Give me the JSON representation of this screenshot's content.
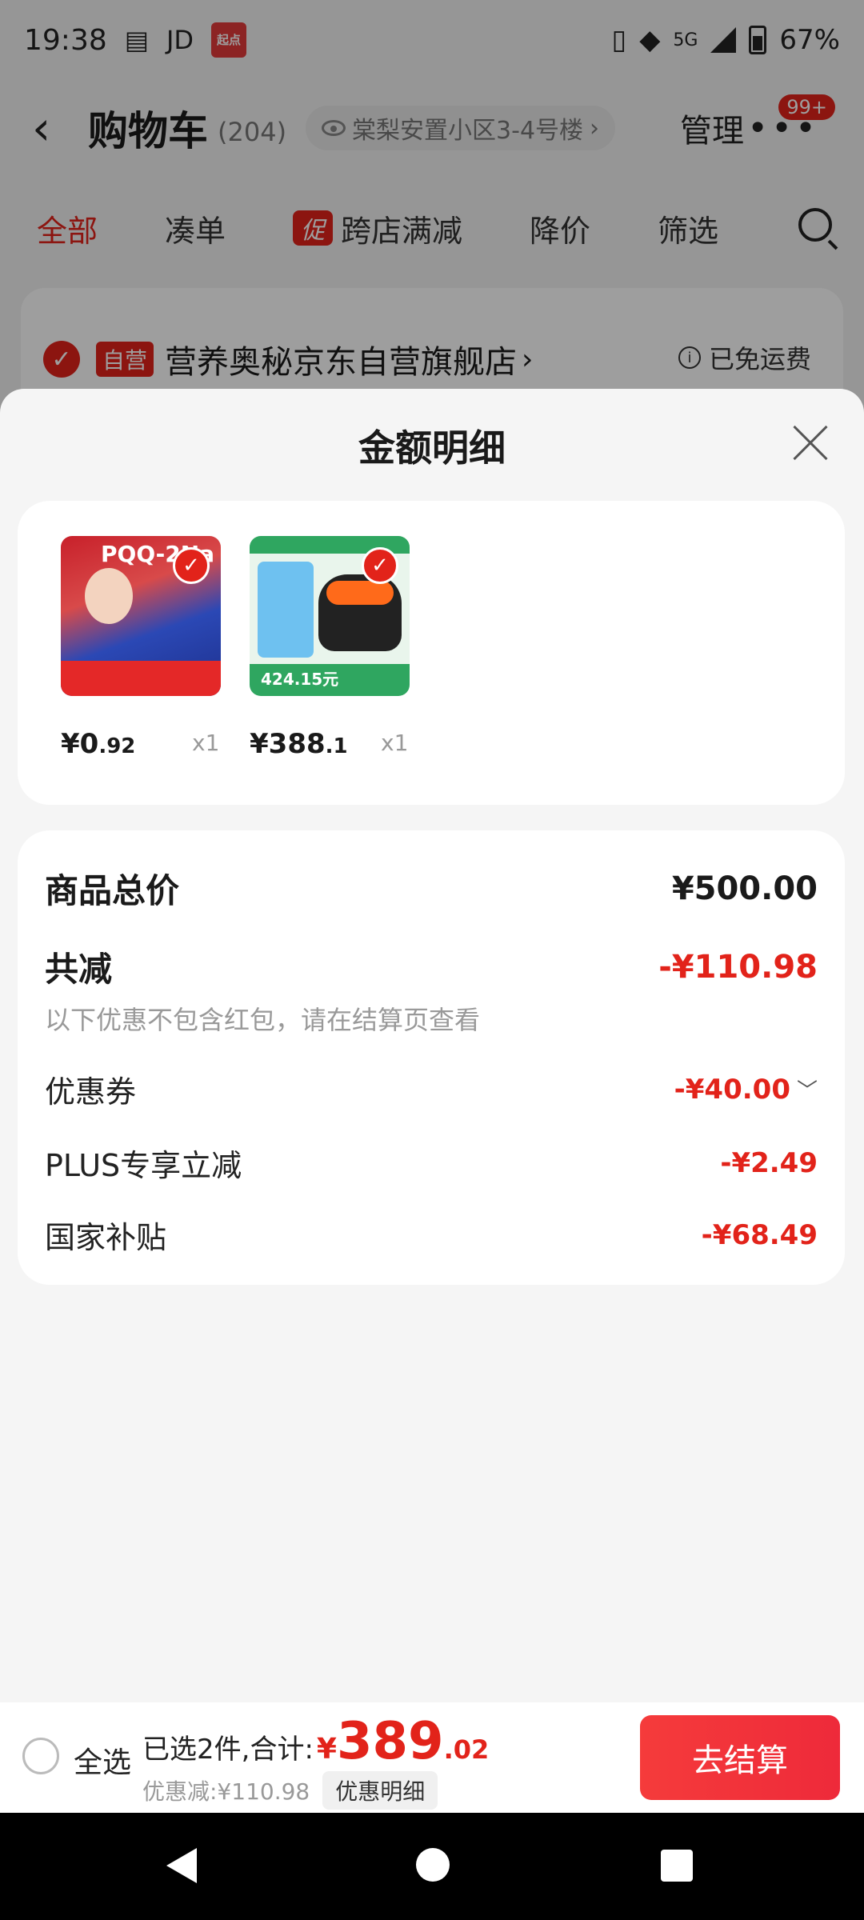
{
  "status_bar": {
    "time": "19:38",
    "jd_label": "JD",
    "app_badge": "起点",
    "network": "5G",
    "battery": "67%"
  },
  "cart_header": {
    "title": "购物车",
    "count": "(204)",
    "address": "棠梨安置小区3-4号楼",
    "manage": "管理",
    "more_badge": "99+"
  },
  "tabs": [
    {
      "label": "全部",
      "active": true
    },
    {
      "label": "凑单"
    },
    {
      "label": "跨店满减",
      "tag": "促"
    },
    {
      "label": "降价"
    },
    {
      "label": "筛选"
    }
  ],
  "shop": {
    "tag": "自营",
    "name": "营养奥秘京东自营旗舰店",
    "shipping": "已免运费"
  },
  "sheet": {
    "title": "金额明细"
  },
  "products": [
    {
      "price_int": "¥0",
      "price_dec": ".92",
      "qty": "x1",
      "image_text": "PQQ-2Na"
    },
    {
      "price_int": "¥388",
      "price_dec": ".1",
      "qty": "x1",
      "image_text": "424.15元"
    }
  ],
  "summary": {
    "total_label": "商品总价",
    "total_value": "¥500.00",
    "reduce_label": "共减",
    "reduce_value": "-¥110.98",
    "reduce_note": "以下优惠不包含红包，请在结算页查看",
    "coupon_label": "优惠券",
    "coupon_value": "-¥40.00",
    "plus_label": "PLUS专享立减",
    "plus_value": "-¥2.49",
    "subsidy_label": "国家补贴",
    "subsidy_value": "-¥68.49"
  },
  "action_bar": {
    "select_all": "全选",
    "selected_text": "已选2件,合计:",
    "currency": "¥",
    "total_int": "389",
    "total_dec": ".02",
    "discount_text": "优惠减:¥110.98",
    "detail_chip": "优惠明细",
    "checkout": "去结算"
  },
  "colors": {
    "accent": "#e2231a",
    "sheet_bg": "#f5f5f5"
  }
}
